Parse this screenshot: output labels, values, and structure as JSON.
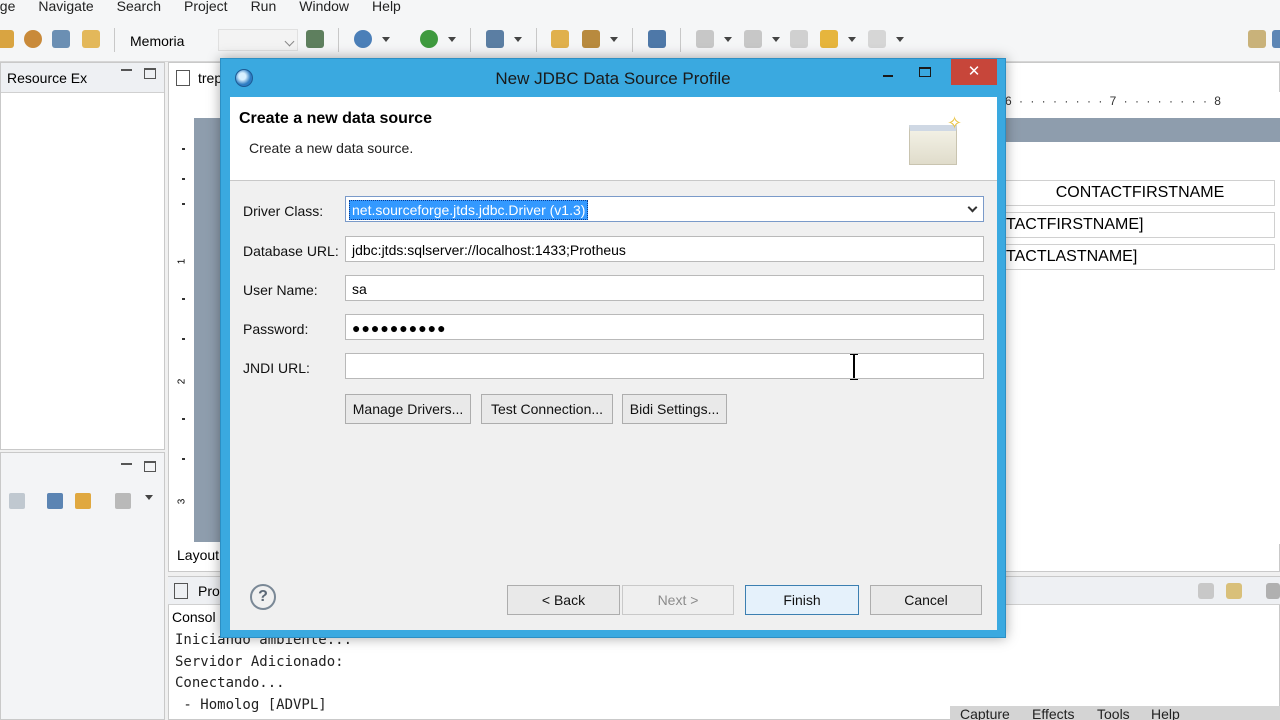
{
  "menu": [
    "age",
    "Navigate",
    "Search",
    "Project",
    "Run",
    "Window",
    "Help"
  ],
  "toolbar": {
    "memoria_label": "Memoria"
  },
  "left_panel": {
    "tab_label": "Resource Ex"
  },
  "editor": {
    "tab_label": "trep",
    "layout_tab": "Layout",
    "ruler_marks": [
      "1",
      "2",
      "3"
    ],
    "ruler_h": "6 · · · · · · · · 7 · · · · · · · · 8",
    "cells": [
      "CONTACTFIRSTNAME",
      "TACTFIRSTNAME]",
      "TACTLASTNAME]"
    ]
  },
  "bottom": {
    "tab_label": "Pro",
    "console_label": "Consol",
    "console_lines": "Iniciando ambiente...\nServidor Adicionado:\nConectando...\n - Homolog [ADVPL]"
  },
  "capture_bar": [
    "Capture",
    "Effects",
    "Tools",
    "Help"
  ],
  "dialog": {
    "title": "New JDBC Data Source Profile",
    "close_glyph": "✕",
    "banner_title": "Create a new data source",
    "banner_subtitle": "Create a new data source.",
    "fields": {
      "driver_class_label": "Driver Class:",
      "driver_class_value": "net.sourceforge.jtds.jdbc.Driver (v1.3)",
      "database_url_label": "Database URL:",
      "database_url_value": "jdbc:jtds:sqlserver://localhost:1433;Protheus",
      "user_name_label": "User Name:",
      "user_name_value": "sa",
      "password_label": "Password:",
      "password_value": "●●●●●●●●●●",
      "jndi_url_label": "JNDI URL:",
      "jndi_url_value": ""
    },
    "buttons": {
      "manage_drivers": "Manage Drivers...",
      "test_connection": "Test Connection...",
      "bidi_settings": "Bidi Settings...",
      "back": "< Back",
      "next": "Next >",
      "finish": "Finish",
      "cancel": "Cancel",
      "help": "?"
    }
  }
}
